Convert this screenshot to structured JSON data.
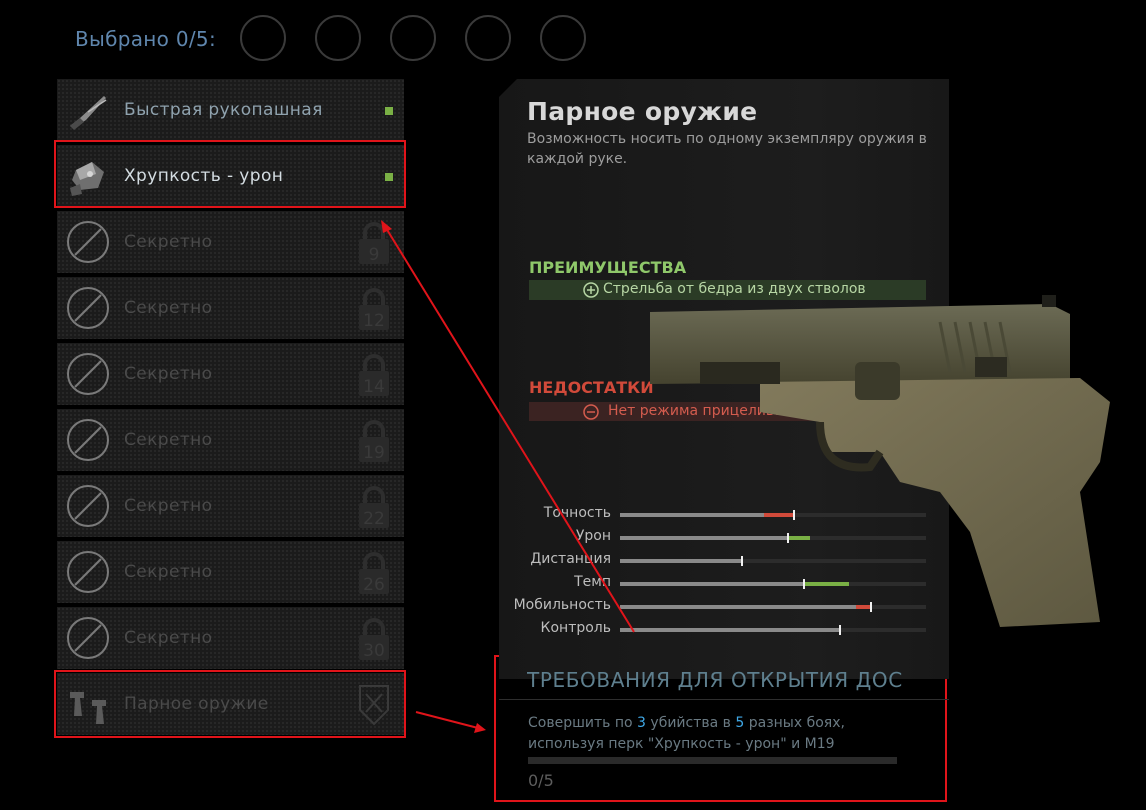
{
  "header": {
    "selected_label": "Выбрано 0/5:"
  },
  "perks": [
    {
      "label": "Быстрая рукопашная",
      "state": "unlocked",
      "icon": "knife-icon",
      "equipped_indicator": true
    },
    {
      "label": "Хрупкость - урон",
      "state": "unlocked",
      "icon": "explosive-icon",
      "equipped_indicator": true,
      "highlighted": true
    },
    {
      "label": "Секретно",
      "state": "locked",
      "icon": "secret-icon",
      "level": "9"
    },
    {
      "label": "Секретно",
      "state": "locked",
      "icon": "secret-icon",
      "level": "12"
    },
    {
      "label": "Секретно",
      "state": "locked",
      "icon": "secret-icon",
      "level": "14"
    },
    {
      "label": "Секретно",
      "state": "locked",
      "icon": "secret-icon",
      "level": "19"
    },
    {
      "label": "Секретно",
      "state": "locked",
      "icon": "secret-icon",
      "level": "22"
    },
    {
      "label": "Секретно",
      "state": "locked",
      "icon": "secret-icon",
      "level": "26"
    },
    {
      "label": "Секретно",
      "state": "locked",
      "icon": "secret-icon",
      "level": "30"
    },
    {
      "label": "Парное оружие",
      "state": "challenge",
      "icon": "dual-pistols-icon",
      "highlighted": true
    }
  ],
  "detail": {
    "title": "Парное оружие",
    "description": "Возможность носить по одному экземпляру оружия в каждой руке.",
    "advantages_title": "ПРЕИМУЩЕСТВА",
    "advantage": "Стрельба от бедра из двух стволов",
    "disadvantages_title": "НЕДОСТАТКИ",
    "disadvantage": "Нет режима прицеливания"
  },
  "stats": [
    {
      "name": "Точность",
      "base": 0.57,
      "value": 0.47,
      "change": "negative"
    },
    {
      "name": "Урон",
      "base": 0.55,
      "value": 0.62,
      "change": "positive"
    },
    {
      "name": "Дистанция",
      "base": 0.4,
      "value": 0.4,
      "change": "none"
    },
    {
      "name": "Темп",
      "base": 0.6,
      "value": 0.75,
      "change": "positive"
    },
    {
      "name": "Мобильность",
      "base": 0.82,
      "value": 0.77,
      "change": "negative"
    },
    {
      "name": "Контроль",
      "base": 0.72,
      "value": 0.72,
      "change": "none"
    }
  ],
  "requirements": {
    "title": "ТРЕБОВАНИЯ ДЛЯ ОТКРЫТИЯ ДОС",
    "text_part1": "Совершить по ",
    "kills": "3",
    "text_part2": " убийства в ",
    "matches": "5",
    "text_part3": " разных боях,",
    "text_line2": "используя перк \"Хрупкость - урон\" и M19",
    "progress": 0,
    "progress_text": "0/5"
  },
  "colors": {
    "accent_blue": "#5f86ad",
    "highlight_red": "#e0141a",
    "positive": "#7ab045",
    "negative": "#d14a3a",
    "counter_blue": "#3fa8e6"
  }
}
